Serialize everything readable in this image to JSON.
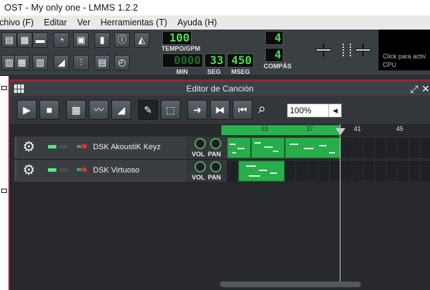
{
  "window": {
    "title": "OST - My only one - LMMS 1.2.2"
  },
  "menu": [
    "rchivo (F)",
    "Editar",
    "Ver",
    "Herramientas (T)",
    "Ayuda (H)"
  ],
  "transport": {
    "tempo": "100",
    "tempo_label": "TEMPO/GPM",
    "min": "0000",
    "seg": "33",
    "mseg": "450",
    "min_label": "MIN",
    "seg_label": "SEG",
    "mseg_label": "MSEG",
    "compas_top": "4",
    "compas_bottom": "4",
    "compas_label": "COMPÁS"
  },
  "cpu": {
    "hint": "Click para activ",
    "label": "CPU"
  },
  "song_editor": {
    "title": "Editor de Canción",
    "zoom": "100%",
    "bars": [
      "33",
      "37",
      "41",
      "45"
    ]
  },
  "tracks": [
    {
      "name": "DSK AkoustiK Keyz",
      "vol_label": "VOL",
      "pan_label": "PAN"
    },
    {
      "name": "DSK Virtuoso",
      "vol_label": "VOL",
      "pan_label": "PAN"
    }
  ],
  "colors": {
    "accent_green": "#28b34d",
    "window_red": "#a3222b",
    "lcd_green": "#43e14b"
  },
  "icons": [
    "play-icon",
    "stop-icon",
    "add-beat-track-icon",
    "add-sample-track-icon",
    "add-automation-track-icon",
    "draw-mode-icon",
    "select-mode-icon",
    "follow-icon",
    "stop-behavior-icon",
    "back-to-start-icon",
    "zoom-icon",
    "gear-icon"
  ]
}
